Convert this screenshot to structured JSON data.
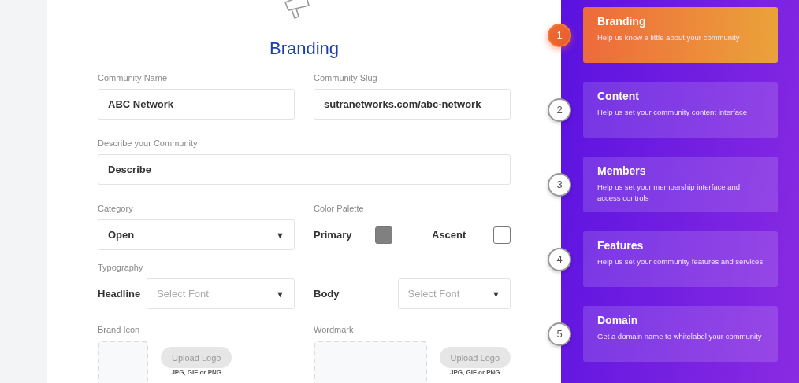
{
  "form": {
    "title": "Branding",
    "community_name": {
      "label": "Community Name",
      "value": "ABC Network"
    },
    "community_slug": {
      "label": "Community Slug",
      "value": "sutranetworks.com/abc-network"
    },
    "description": {
      "label": "Describe your Community",
      "value": "Describe"
    },
    "category": {
      "label": "Category",
      "value": "Open",
      "arrow": "▼"
    },
    "color_palette": {
      "label": "Color Palette",
      "swatches": [
        {
          "label": "Primary",
          "color": "#808080"
        },
        {
          "label": "Ascent",
          "color": "#ffffff"
        }
      ]
    },
    "typography": {
      "label": "Typography",
      "selects": [
        {
          "label": "Headline",
          "placeholder": "Select Font",
          "arrow": "▼"
        },
        {
          "label": "Body",
          "placeholder": "Select Font",
          "arrow": "▼"
        }
      ]
    },
    "uploads": [
      {
        "label": "Brand Icon",
        "kind": "square",
        "button": "Upload Logo",
        "hint": "JPG, GIF or PNG"
      },
      {
        "label": "Wordmark",
        "kind": "wide",
        "button": "Upload Logo",
        "hint": "JPG, GIF or PNG"
      }
    ]
  },
  "steps": [
    {
      "number": "1",
      "title": "Branding",
      "description": "Help us know a little about your community",
      "selected": true
    },
    {
      "number": "2",
      "title": "Content",
      "description": "Help us set your community content interface",
      "selected": false
    },
    {
      "number": "3",
      "title": "Members",
      "description": "Help us set your membership interface and access controls",
      "selected": false
    },
    {
      "number": "4",
      "title": "Features",
      "description": "Help us set your community features and services",
      "selected": false
    },
    {
      "number": "5",
      "title": "Domain",
      "description": "Get a domain name to whitelabel your community",
      "selected": false
    }
  ]
}
